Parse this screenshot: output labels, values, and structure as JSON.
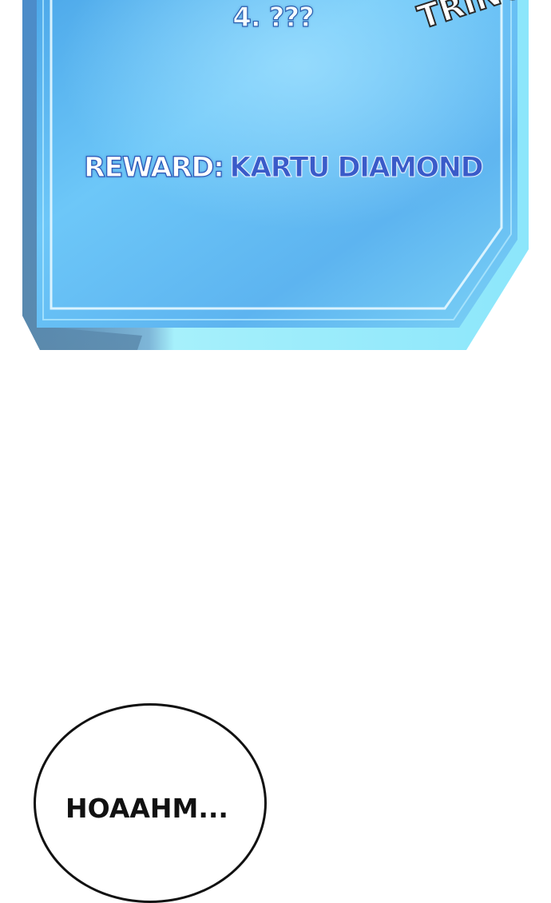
{
  "system_window": {
    "quest_item": "4. ???",
    "reward_label": "REWARD:",
    "reward_value": "KARTU DIAMOND"
  },
  "sound_effect": "TRING-",
  "speech_bubble": {
    "text": "HOAAHM..."
  },
  "colors": {
    "panel_light": "#6cc6f7",
    "panel_mid": "#4aa9ee",
    "panel_edge": "#8fe4fb",
    "panel_shadow": "#5a86a8",
    "text_outline": "#2b5fb0",
    "reward_value": "#3a5bc9",
    "bubble_border": "#111111"
  }
}
